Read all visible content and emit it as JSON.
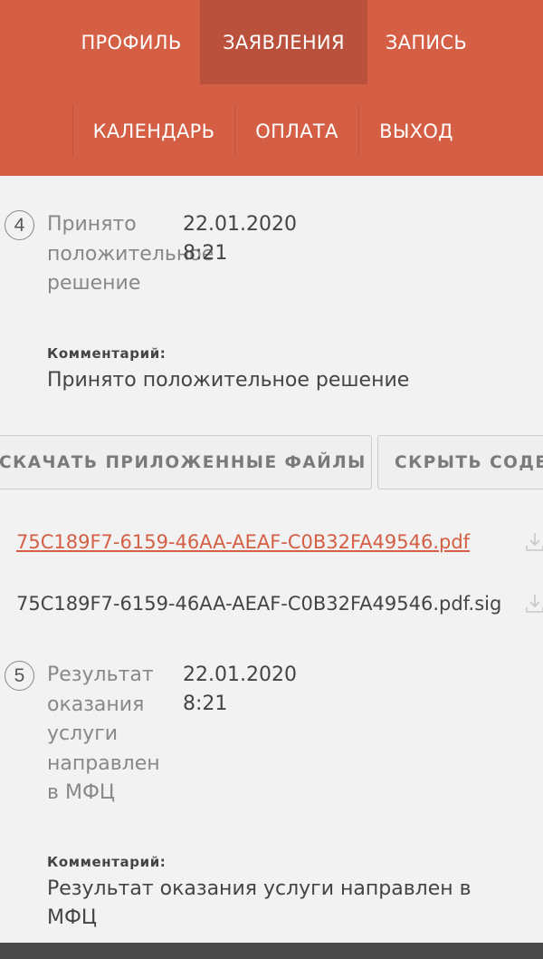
{
  "nav": {
    "row1": [
      "ПРОФИЛЬ",
      "ЗАЯВЛЕНИЯ",
      "ЗАПИСЬ"
    ],
    "row2": [
      "КАЛЕНДАРЬ",
      "ОПЛАТА",
      "ВЫХОД"
    ],
    "active": "ЗАЯВЛЕНИЯ"
  },
  "steps": [
    {
      "number": "4",
      "title": "Принято\nположительное\nрешение",
      "date": "22.01.2020",
      "time": "8:21",
      "comment_label": "Комментарий:",
      "comment": "Принято положительное решение"
    },
    {
      "number": "5",
      "title": "Результат\nоказания\nуслуги\nнаправлен\nв МФЦ",
      "date": "22.01.2020",
      "time": "8:21",
      "comment_label": "Комментарий:",
      "comment_line1": "Результат оказания услуги направлен в",
      "comment_line2": "МФЦ"
    }
  ],
  "buttons": {
    "download": "СКАЧАТЬ ПРИЛОЖЕННЫЕ ФАЙЛЫ",
    "hide": "СКРЫТЬ СОДЕРЖИМОЕ"
  },
  "files": [
    {
      "name": "75C189F7-6159-46AA-AEAF-C0B32FA49546.pdf",
      "icon": "download-icon"
    },
    {
      "name": "75C189F7-6159-46AA-AEAF-C0B32FA49546.pdf.sig",
      "icon": "download-icon"
    }
  ],
  "colors": {
    "accent": "#d45f45",
    "accent_active": "#b9513c",
    "background": "#f2f2f2"
  }
}
